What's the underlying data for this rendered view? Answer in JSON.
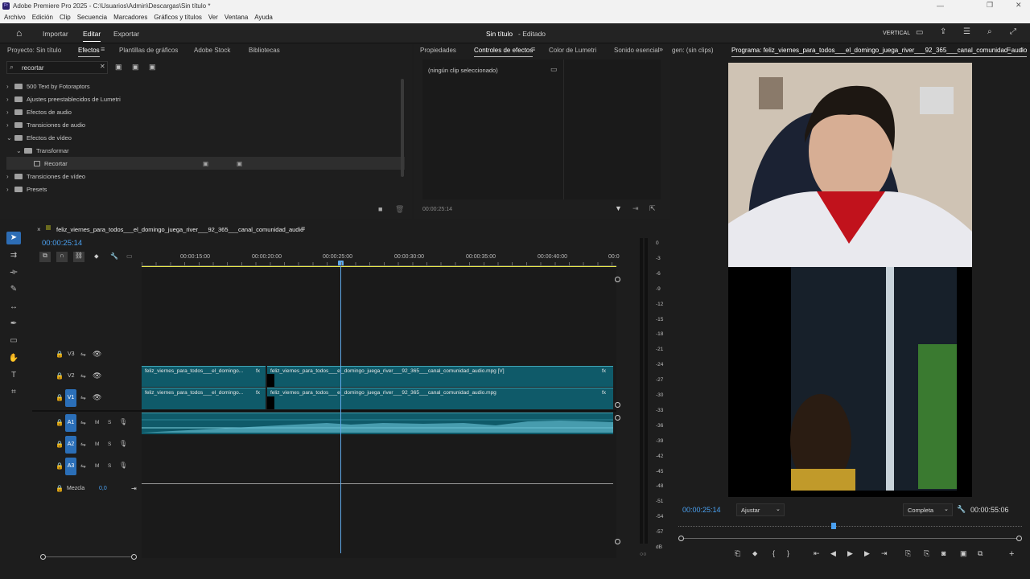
{
  "window": {
    "title": "Adobe Premiere Pro 2025 - C:\\Usuarios\\Admin\\Descargas\\Sin título *"
  },
  "menu": [
    "Archivo",
    "Edición",
    "Clip",
    "Secuencia",
    "Marcadores",
    "Gráficos y títulos",
    "Ver",
    "Ventana",
    "Ayuda"
  ],
  "workspace": {
    "tabs": [
      "Importar",
      "Editar",
      "Exportar"
    ],
    "active": "Editar",
    "project_title": "Sin título",
    "project_status": "- Editado",
    "mode_label": "VERTICAL"
  },
  "effects_panel": {
    "tabs": [
      "Proyecto: Sin título",
      "Efectos",
      "Plantillas de gráficos",
      "Adobe Stock",
      "Bibliotecas"
    ],
    "search_value": "recortar",
    "tree": [
      {
        "label": "500 Text by Fotoraptors",
        "expanded": false,
        "indent": 0,
        "type": "folder"
      },
      {
        "label": "Ajustes preestablecidos de Lumetri",
        "expanded": false,
        "indent": 0,
        "type": "folder"
      },
      {
        "label": "Efectos de audio",
        "expanded": false,
        "indent": 0,
        "type": "folder"
      },
      {
        "label": "Transiciones de audio",
        "expanded": false,
        "indent": 0,
        "type": "folder"
      },
      {
        "label": "Efectos de vídeo",
        "expanded": true,
        "indent": 0,
        "type": "folder"
      },
      {
        "label": "Transformar",
        "expanded": true,
        "indent": 1,
        "type": "folder"
      },
      {
        "label": "Recortar",
        "expanded": false,
        "indent": 2,
        "type": "effect"
      },
      {
        "label": "Transiciones de vídeo",
        "expanded": false,
        "indent": 0,
        "type": "folder"
      },
      {
        "label": "Presets",
        "expanded": false,
        "indent": 0,
        "type": "folder"
      }
    ]
  },
  "effect_controls": {
    "tabs": [
      "Propiedades",
      "Controles de efectos",
      "Color de Lumetri",
      "Sonido esencial"
    ],
    "status": "(ningún clip seleccionado)",
    "timecode": "00:00:25:14"
  },
  "program_monitor": {
    "source_tab": "gen: (sin clips)",
    "tab": "Programa: feliz_viernes_para_todos___el_domingo_juega_river___92_365___canal_comunidad_audio",
    "timecode": "00:00:25:14",
    "fit": "Ajustar",
    "quality": "Completa",
    "duration": "00:00:55:06"
  },
  "timeline": {
    "sequence": "feliz_viernes_para_todos___el_domingo_juega_river___92_365___canal_comunidad_audio",
    "timecode": "00:00:25:14",
    "ruler": [
      "00:00:15:00",
      "00:00:20:00",
      "00:00:25:00",
      "00:00:30:00",
      "00:00:35:00",
      "00:00:40:00",
      "00:0"
    ],
    "video_tracks": [
      "V3",
      "V2",
      "V1"
    ],
    "audio_tracks": [
      "A1",
      "A2",
      "A3"
    ],
    "mix_label": "Mezcla",
    "mix_value": "0,0",
    "clips": {
      "v2_a": "feliz_viernes_para_todos___el_domingo...",
      "v2_b": "feliz_viernes_para_todos___el_domingo_juega_river___92_365___canal_comunidad_audio.mpg [V]",
      "v1_a": "feliz_viernes_para_todos___el_domingo...",
      "v1_b": "feliz_viernes_para_todos___el_domingo_juega_river___92_365___canal_comunidad_audio.mpg",
      "fx": "fx"
    }
  },
  "audio_meter": {
    "labels": [
      "0",
      "-3",
      "-6",
      "-9",
      "-12",
      "-15",
      "-18",
      "-21",
      "-24",
      "-27",
      "-30",
      "-33",
      "-36",
      "-39",
      "-42",
      "-45",
      "-48",
      "-51",
      "-54",
      "-57",
      "dB"
    ]
  },
  "colors": {
    "accent": "#2d8ceb",
    "clip": "#0f5a69",
    "playhead": "#5fa8e8",
    "work_area": "#e8e84a"
  }
}
